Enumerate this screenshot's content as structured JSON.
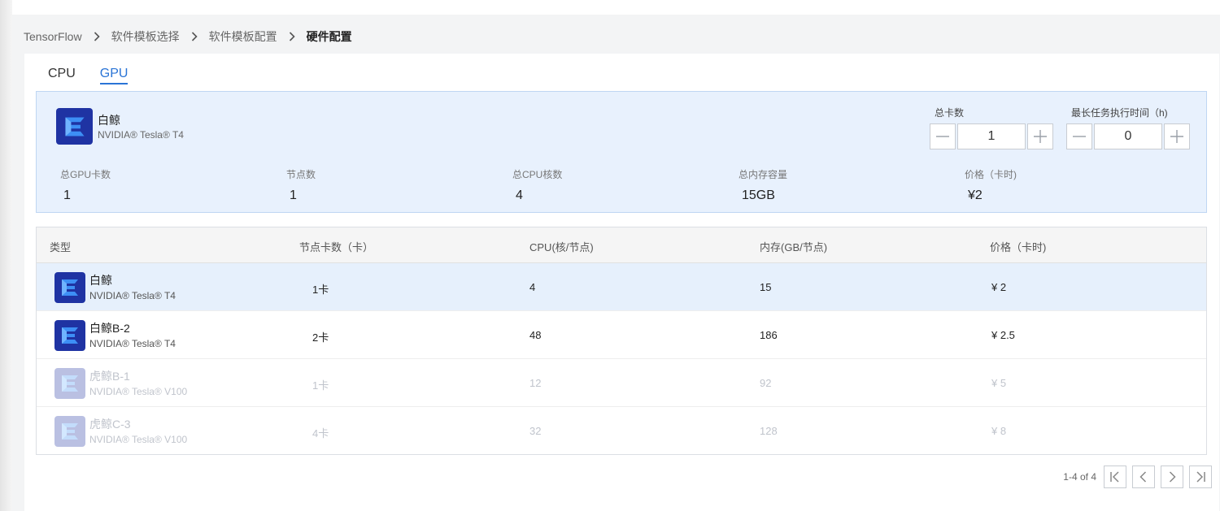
{
  "breadcrumb": {
    "items": [
      "TensorFlow",
      "软件模板选择",
      "软件模板配置"
    ],
    "current": "硬件配置"
  },
  "tabs": [
    {
      "label": "CPU",
      "active": false
    },
    {
      "label": "GPU",
      "active": true
    }
  ],
  "summary": {
    "name": "白鲸",
    "model": "NVIDIA® Tesla® T4",
    "total_cards": {
      "label": "总卡数",
      "value": "1"
    },
    "max_time": {
      "label": "最长任务执行时间（h)",
      "value": "0"
    },
    "stats": [
      {
        "label": "总GPU卡数",
        "value": "1"
      },
      {
        "label": "节点数",
        "value": "1"
      },
      {
        "label": "总CPU核数",
        "value": "4"
      },
      {
        "label": "总内存容量",
        "value": "15GB"
      },
      {
        "label": "价格（卡时)",
        "value": "¥2"
      }
    ]
  },
  "table": {
    "headers": [
      "类型",
      "节点卡数（卡）",
      "CPU(核/节点)",
      "内存(GB/节点)",
      "价格（卡时)"
    ],
    "rows": [
      {
        "name": "白鲸",
        "model": "NVIDIA® Tesla® T4",
        "cards": "1卡",
        "cpu": "4",
        "mem": "15",
        "price": "¥ 2",
        "state": "selected"
      },
      {
        "name": "白鲸B-2",
        "model": "NVIDIA® Tesla® T4",
        "cards": "2卡",
        "cpu": "48",
        "mem": "186",
        "price": "¥ 2.5",
        "state": "normal"
      },
      {
        "name": "虎鲸B-1",
        "model": "NVIDIA® Tesla® V100",
        "cards": "1卡",
        "cpu": "12",
        "mem": "92",
        "price": "¥ 5",
        "state": "disabled"
      },
      {
        "name": "虎鲸C-3",
        "model": "NVIDIA® Tesla® V100",
        "cards": "4卡",
        "cpu": "32",
        "mem": "128",
        "price": "¥ 8",
        "state": "disabled"
      }
    ]
  },
  "pagination": {
    "info": "1-4 of 4"
  },
  "colors": {
    "accent": "#2a74d6",
    "logo_bg": "#1f33a3",
    "selected_row": "#e6f0fc",
    "summary_bg": "#e8f1fd"
  },
  "icons": [
    "chevron-right-icon",
    "gpu-logo-icon",
    "minus-icon",
    "plus-icon",
    "first-page-icon",
    "prev-page-icon",
    "next-page-icon",
    "last-page-icon"
  ]
}
